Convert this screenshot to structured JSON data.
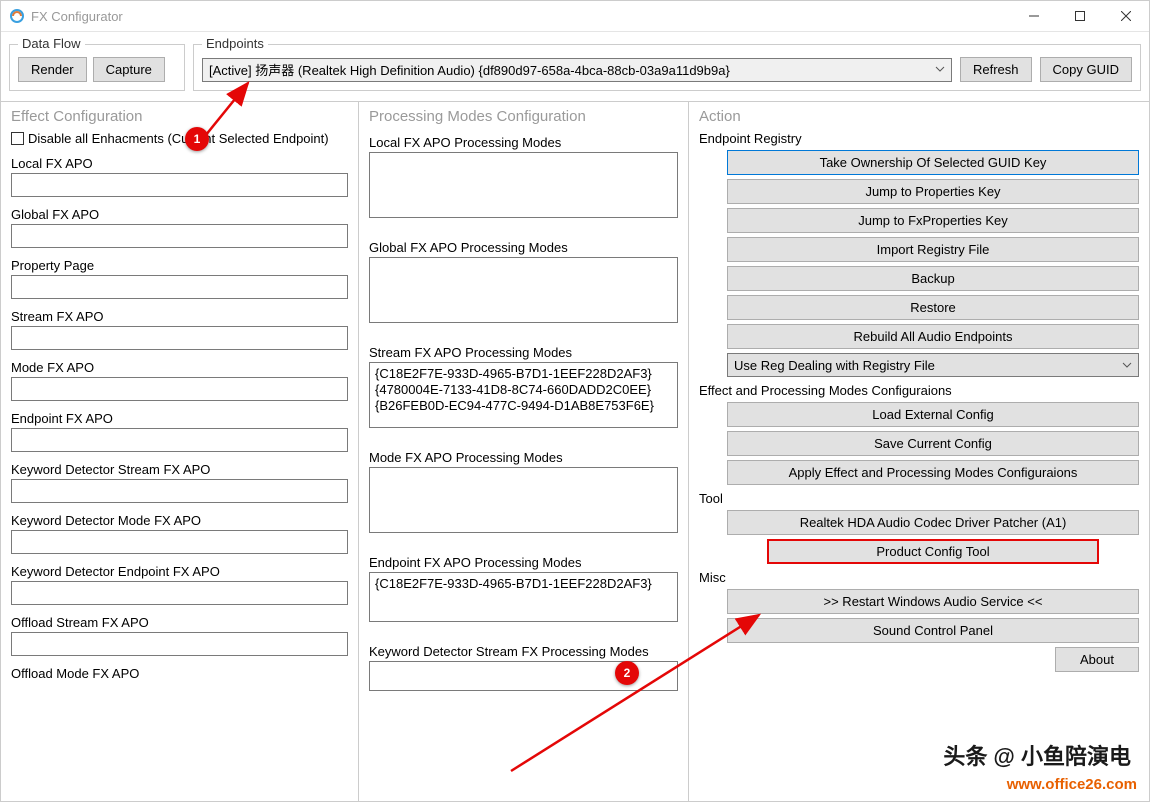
{
  "window": {
    "title": "FX Configurator"
  },
  "top": {
    "dataflow": {
      "label": "Data Flow",
      "render": "Render",
      "capture": "Capture"
    },
    "endpoints": {
      "label": "Endpoints",
      "selected": "[Active] 扬声器 (Realtek High Definition Audio) {df890d97-658a-4bca-88cb-03a9a11d9b9a}",
      "refresh": "Refresh",
      "copyguid": "Copy GUID"
    }
  },
  "left": {
    "title": "Effect Configuration",
    "disable_all": "Disable all Enhacments (Current Selected Endpoint)",
    "labels": {
      "local": "Local FX APO",
      "global": "Global FX APO",
      "property": "Property Page",
      "stream": "Stream FX APO",
      "mode": "Mode FX APO",
      "endpoint": "Endpoint FX APO",
      "kd_stream": "Keyword Detector Stream FX APO",
      "kd_mode": "Keyword Detector Mode FX APO",
      "kd_endpoint": "Keyword Detector Endpoint FX APO",
      "off_stream": "Offload Stream FX APO",
      "off_mode": "Offload Mode FX APO"
    }
  },
  "mid": {
    "title": "Processing Modes Configuration",
    "labels": {
      "local": "Local FX APO Processing Modes",
      "global": "Global FX APO Processing Modes",
      "stream": "Stream FX APO Processing Modes",
      "mode": "Mode FX APO Processing Modes",
      "endpoint": "Endpoint FX APO Processing Modes",
      "kd_stream": "Keyword Detector Stream FX Processing Modes"
    },
    "stream_vals": [
      "{C18E2F7E-933D-4965-B7D1-1EEF228D2AF3}",
      "{4780004E-7133-41D8-8C74-660DADD2C0EE}",
      "{B26FEB0D-EC94-477C-9494-D1AB8E753F6E}"
    ],
    "endpoint_vals": [
      "{C18E2F7E-933D-4965-B7D1-1EEF228D2AF3}"
    ]
  },
  "right": {
    "title": "Action",
    "endpoint_registry": {
      "label": "Endpoint Registry",
      "b1": "Take Ownership Of Selected GUID Key",
      "b2": "Jump to Properties Key",
      "b3": "Jump to FxProperties Key",
      "b4": "Import Registry File",
      "b5": "Backup",
      "b6": "Restore",
      "b7": "Rebuild All Audio Endpoints",
      "select": "Use Reg Dealing with Registry File"
    },
    "config": {
      "label": "Effect and Processing Modes Configuraions",
      "b1": "Load External Config",
      "b2": "Save Current Config",
      "b3": "Apply Effect and Processing Modes Configuraions"
    },
    "tool": {
      "label": "Tool",
      "b1": "Realtek HDA Audio Codec Driver Patcher (A1)",
      "b2": "Product Config Tool"
    },
    "misc": {
      "label": "Misc",
      "b1": ">> Restart Windows Audio Service <<",
      "b2": "Sound Control Panel",
      "about": "About"
    }
  },
  "annotations": {
    "badge1": "1",
    "badge2": "2"
  },
  "watermark": {
    "line1": "头条 @ 小鱼陪演电",
    "line2": "www.office26.com"
  }
}
